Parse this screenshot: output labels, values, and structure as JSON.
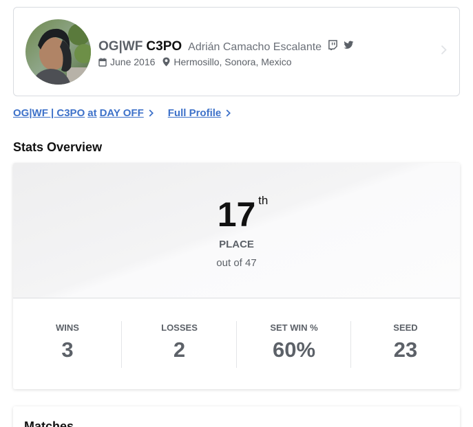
{
  "profile": {
    "prefix": "OG|WF",
    "gamertag": "C3PO",
    "real_name": "Adrián Camacho Escalante",
    "social_icons": [
      "twitch-icon",
      "twitter-icon"
    ],
    "joined": "June 2016",
    "location": "Hermosillo, Sonora, Mexico"
  },
  "links": {
    "entrant_tag": "OG|WF | C3PO",
    "entrant_at": "at",
    "event_name": "DAY OFF",
    "full_profile": "Full Profile"
  },
  "stats_overview": {
    "title": "Stats Overview",
    "placement": "17",
    "placement_suffix": "th",
    "placement_label": "PLACE",
    "out_of": "out of 47",
    "stats": [
      {
        "label": "WINS",
        "value": "3"
      },
      {
        "label": "LOSSES",
        "value": "2"
      },
      {
        "label": "SET WIN %",
        "value": "60%"
      },
      {
        "label": "SEED",
        "value": "23"
      }
    ]
  },
  "matches": {
    "title": "Matches"
  },
  "colors": {
    "link": "#3d71c9",
    "muted_text": "#5c6168",
    "heading": "#111111"
  }
}
